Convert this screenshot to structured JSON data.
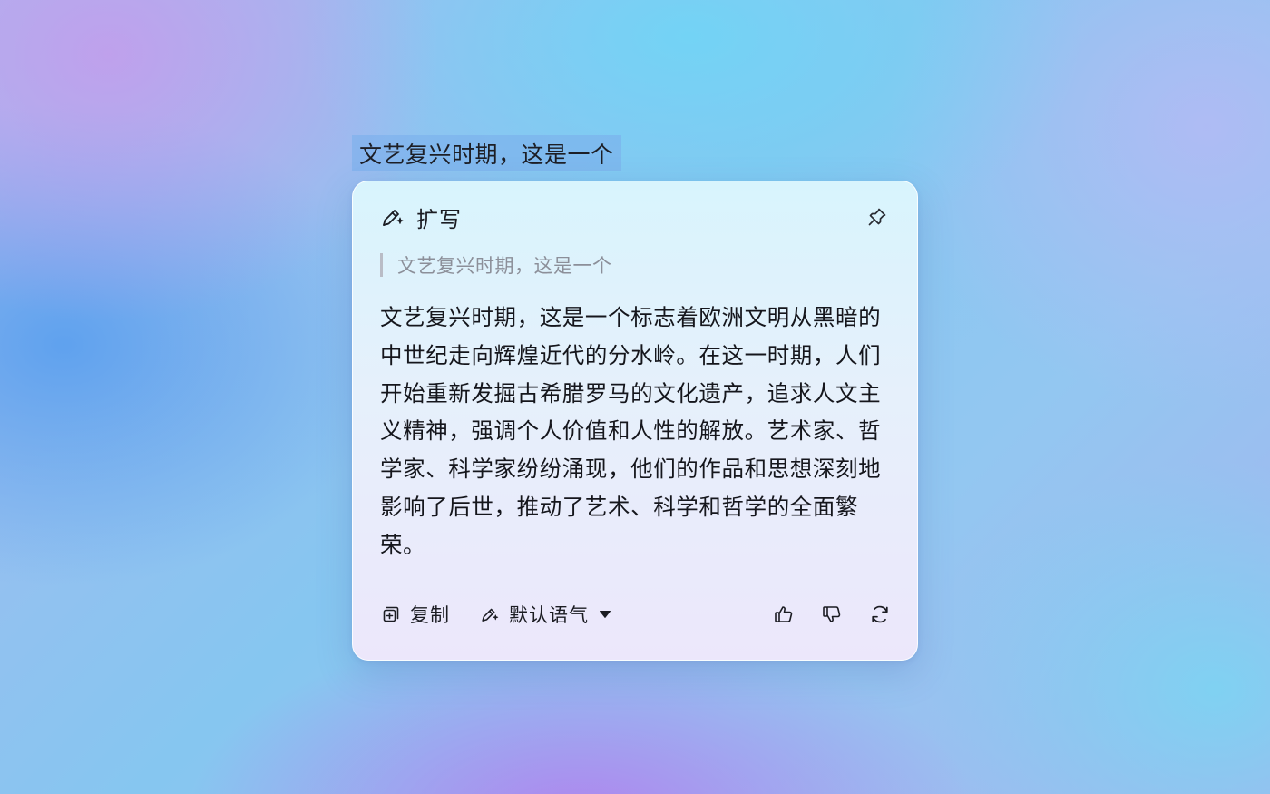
{
  "selected_text": "文艺复兴时期，这是一个",
  "panel": {
    "title": "扩写",
    "title_icon": "ai-pen-sparkle-icon",
    "pin_icon": "pin-icon",
    "quote": "文艺复兴时期，这是一个",
    "result": "文艺复兴时期，这是一个标志着欧洲文明从黑暗的中世纪走向辉煌近代的分水岭。在这一时期，人们开始重新发掘古希腊罗马的文化遗产，追求人文主义精神，强调个人价值和人性的解放。艺术家、哲学家、科学家纷纷涌现，他们的作品和思想深刻地影响了后世，推动了艺术、科学和哲学的全面繁荣。"
  },
  "toolbar": {
    "copy_label": "复制",
    "copy_icon": "copy-icon",
    "tone_label": "默认语气",
    "tone_icon": "ai-pen-sparkle-icon",
    "tone_caret_icon": "caret-down-icon",
    "like_icon": "thumbs-up-icon",
    "dislike_icon": "thumbs-down-icon",
    "regenerate_icon": "refresh-icon"
  },
  "colors": {
    "selection_highlight": "#7ab0ec",
    "text_primary": "#15161c",
    "text_muted": "#8c8f99"
  }
}
